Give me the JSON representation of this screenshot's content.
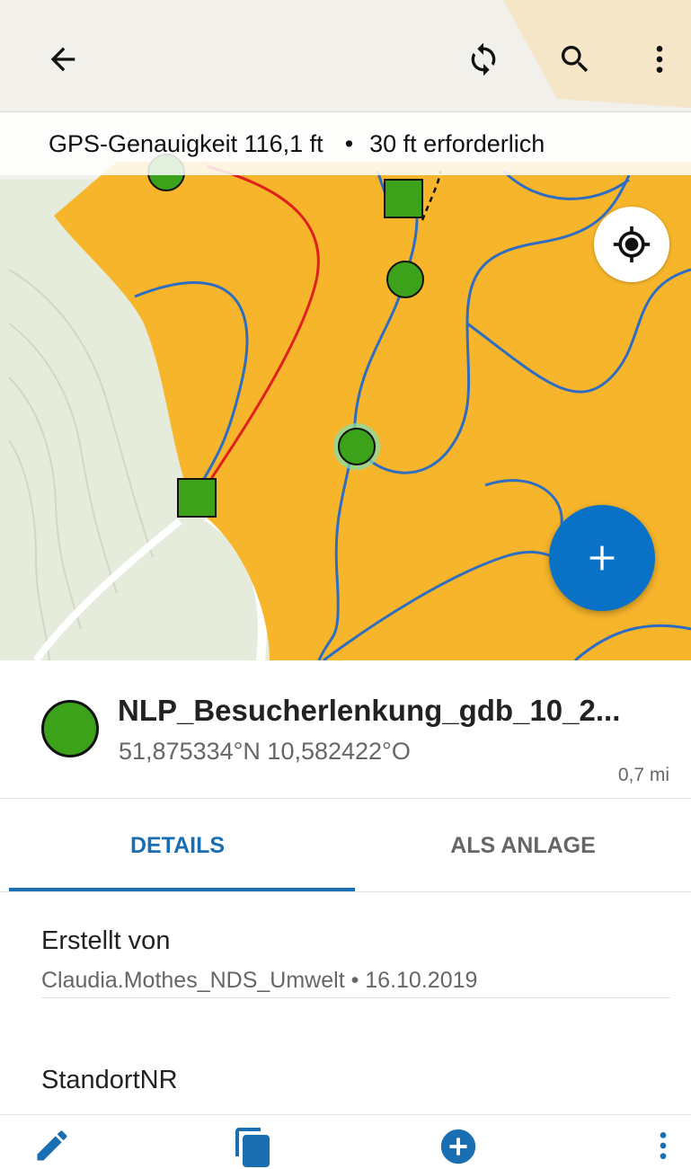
{
  "toolbar": {
    "back_icon": "arrow-left-icon",
    "sync_icon": "sync-icon",
    "search_icon": "search-icon",
    "menu_icon": "more-vertical-icon"
  },
  "gps": {
    "accuracy_text": "GPS-Genauigkeit 116,1 ft",
    "separator": "•",
    "required_text": "30 ft erforderlich"
  },
  "map": {
    "colors": {
      "forest_polygon": "#f7b52b",
      "background": "#e3ebd7",
      "trail_blue": "#2e6dc2",
      "trail_red": "#e0201c",
      "point_fill": "#3ba21a"
    },
    "locate_icon": "crosshair-icon",
    "add_icon": "plus-icon"
  },
  "feature": {
    "title": "NLP_Besucherlenkung_gdb_10_2...",
    "coords": "51,875334°N  10,582422°O",
    "distance": "0,7 mi",
    "symbol_color": "#3ba21a"
  },
  "tabs": [
    {
      "label": "DETAILS",
      "active": true
    },
    {
      "label": "ALS ANLAGE",
      "active": false
    }
  ],
  "fields": [
    {
      "label": "Erstellt von",
      "value": "Claudia.Mothes_NDS_Umwelt • 16.10.2019"
    },
    {
      "label": "StandortNR",
      "value": ""
    }
  ],
  "bottom_bar": {
    "edit_icon": "pencil-icon",
    "copy_icon": "copy-icon",
    "add_icon": "add-circle-icon",
    "more_icon": "more-vertical-icon"
  },
  "accent_color": "#1a6fb3"
}
